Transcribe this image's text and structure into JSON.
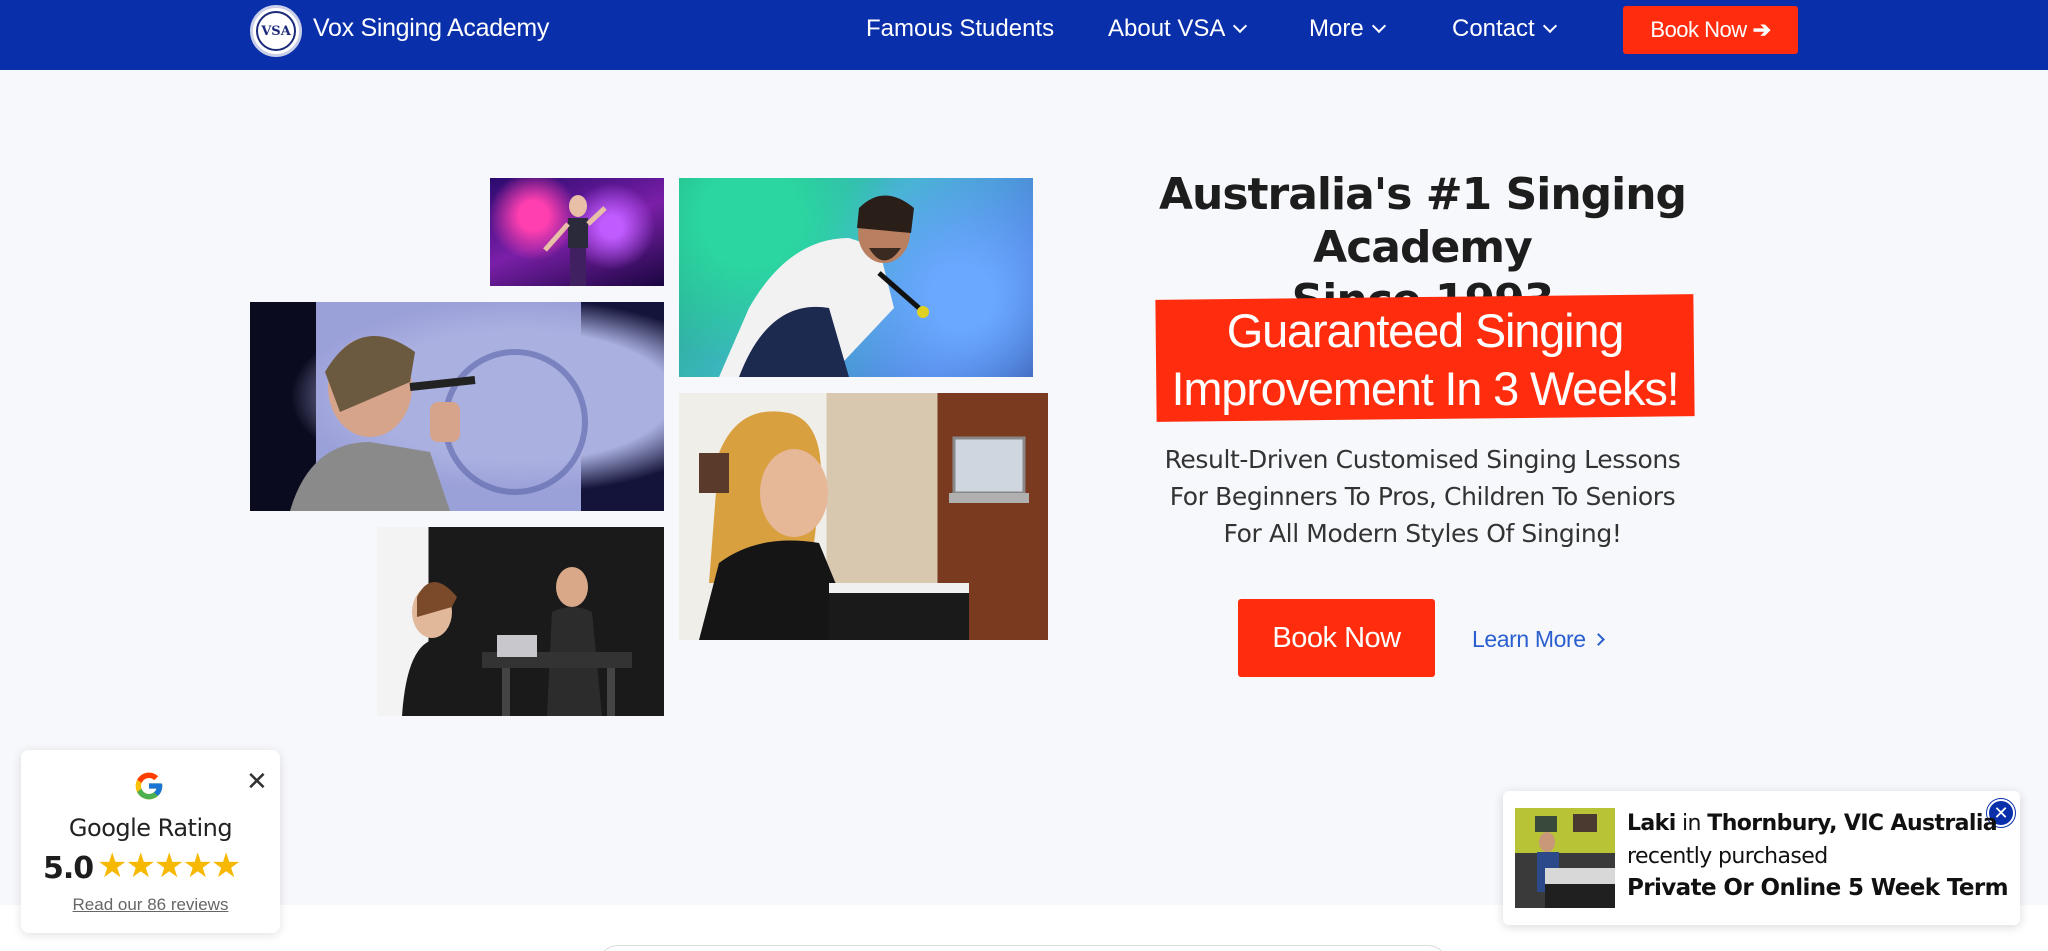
{
  "nav": {
    "logo_text": "VSA",
    "brand": "Vox Singing Academy",
    "links": [
      {
        "label": "Famous Students",
        "dropdown": false
      },
      {
        "label": "About VSA",
        "dropdown": true
      },
      {
        "label": "More",
        "dropdown": true
      },
      {
        "label": "Contact",
        "dropdown": true
      }
    ],
    "book_label": "Book Now",
    "book_icon": "arrow-right-icon"
  },
  "hero": {
    "title_line1": "Australia's #1 Singing Academy",
    "title_line2": "Since 1993",
    "banner_line1": "Guaranteed Singing",
    "banner_line2": "Improvement In 3 Weeks!",
    "sub_line1": "Result-Driven Customised Singing Lessons",
    "sub_line2": "For Beginners To Pros, Children To Seniors",
    "sub_line3": "For All Modern Styles Of Singing!",
    "cta_label": "Book Now",
    "learn_label": "Learn More"
  },
  "google_widget": {
    "title": "Google Rating",
    "score": "5.0",
    "stars": "★★★★★",
    "rating_stars": 5,
    "reviews_link": "Read our 86 reviews",
    "close_icon": "close-icon"
  },
  "notification": {
    "name": "Laki",
    "in_word": " in ",
    "location": "Thornbury, VIC Australia",
    "action": "recently purchased",
    "product": "Private Or Online 5 Week Term",
    "close_glyph": "✕"
  },
  "colors": {
    "nav_bg": "#0a2fab",
    "accent_red": "#ff2d0d",
    "link_blue": "#2a5fd0",
    "star_gold": "#f6b800"
  }
}
